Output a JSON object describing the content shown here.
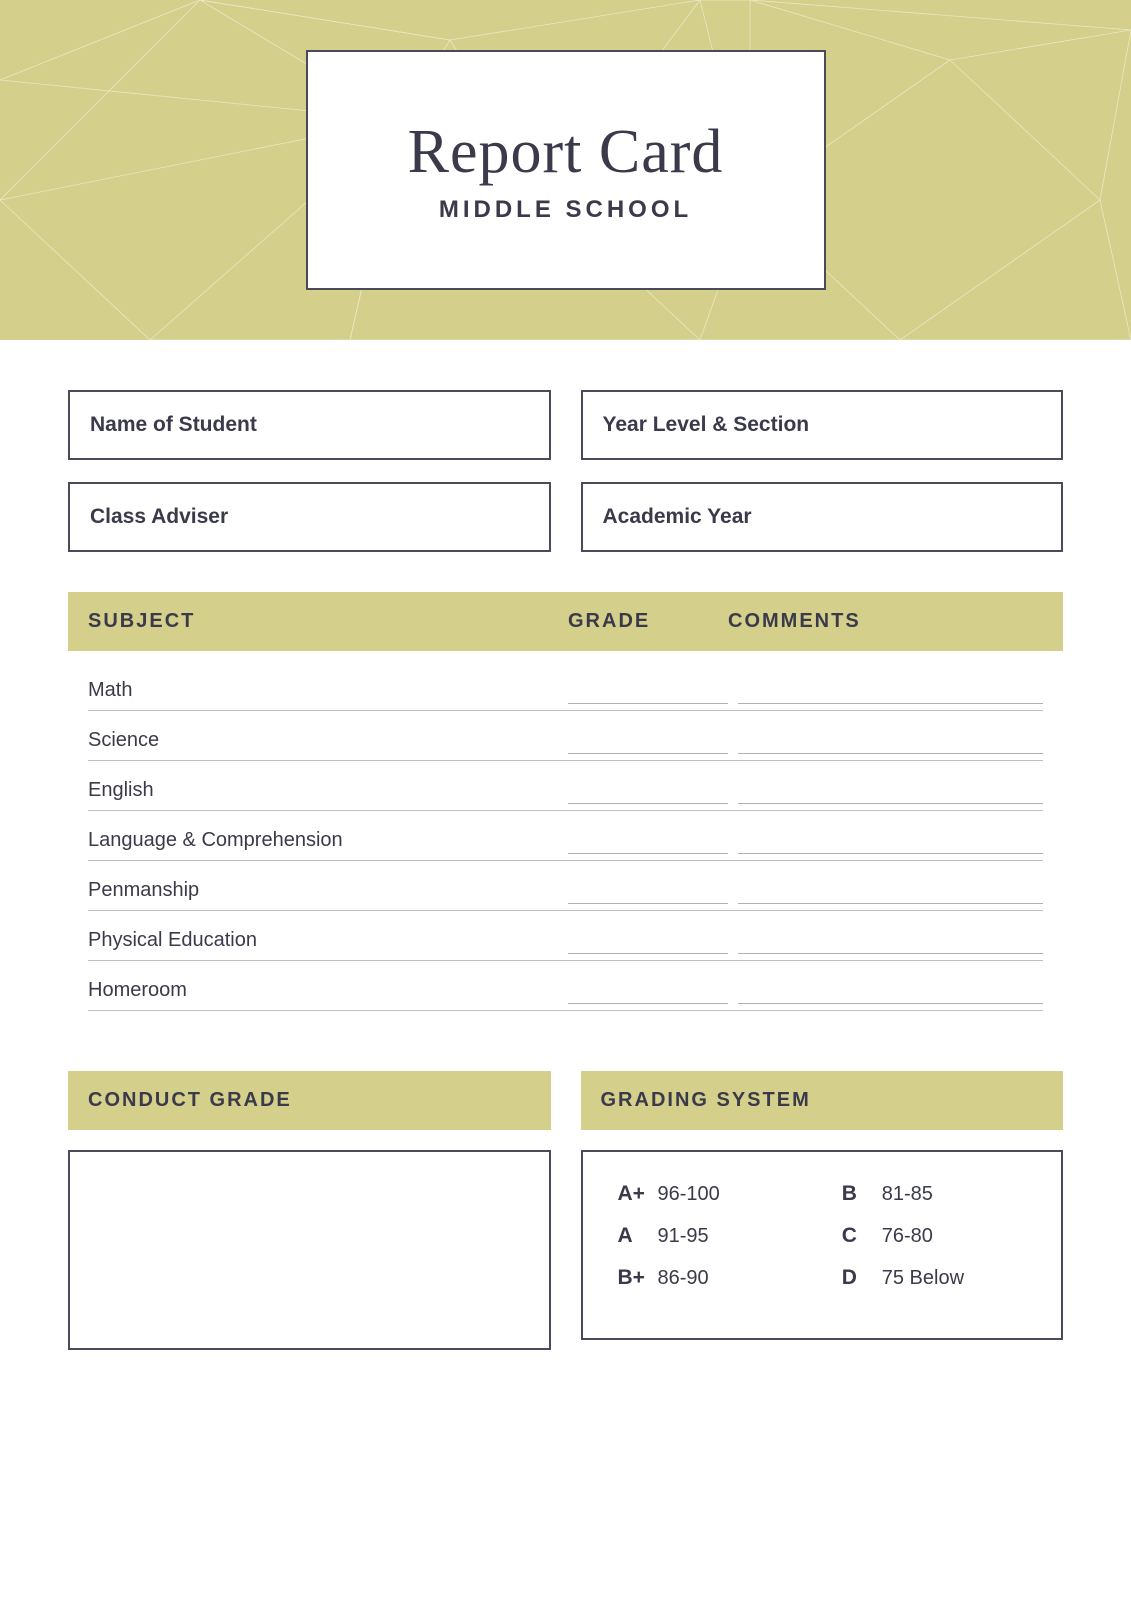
{
  "header": {
    "title": "Report Card",
    "subtitle": "MIDDLE SCHOOL",
    "bg_color": "#d4cf8a"
  },
  "form": {
    "student_name_label": "Name of Student",
    "year_level_label": "Year Level & Section",
    "class_adviser_label": "Class Adviser",
    "academic_year_label": "Academic Year"
  },
  "table": {
    "headers": {
      "subject": "SUBJECT",
      "grade": "GRADE",
      "comments": "COMMENTS"
    },
    "subjects": [
      {
        "name": "Math"
      },
      {
        "name": "Science"
      },
      {
        "name": "English"
      },
      {
        "name": "Language & Comprehension"
      },
      {
        "name": "Penmanship"
      },
      {
        "name": "Physical Education"
      },
      {
        "name": "Homeroom"
      }
    ]
  },
  "conduct": {
    "header": "CONDUCT GRADE"
  },
  "grading": {
    "header": "GRADING SYSTEM",
    "items": [
      {
        "letter": "A+",
        "range": "96-100",
        "letter2": "B",
        "range2": "81-85"
      },
      {
        "letter": "A",
        "range": "91-95",
        "letter2": "C",
        "range2": "76-80"
      },
      {
        "letter": "B+",
        "range": "86-90",
        "letter2": "D",
        "range2": "75 Below"
      }
    ]
  }
}
